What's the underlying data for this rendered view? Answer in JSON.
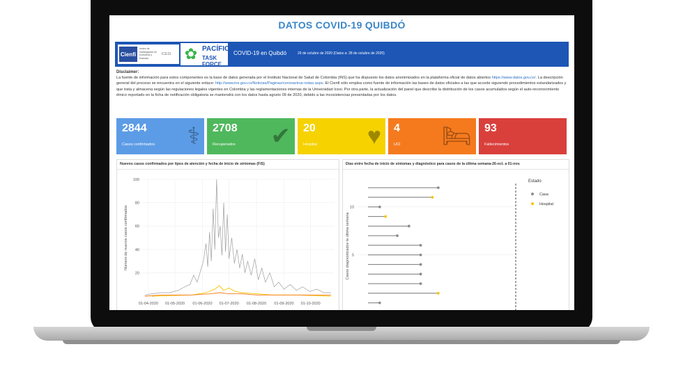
{
  "page": {
    "title": "DATOS COVID-19 QUIBDÓ"
  },
  "header": {
    "cienfi_logo": "Cienfi",
    "cienfi_sub": "centro de investigación en economía y finanzas",
    "icesi_logo": "ICESI",
    "pacifico_title": "PACÍFICO",
    "pacifico_sub": "TASK FORCE",
    "title": "COVID-19 en Quibdó",
    "date": "29 de octubre de 2020 (Datos a: 28 de octubre de 2020)"
  },
  "disclaimer": {
    "heading": "Disclaimer:",
    "p1": "La fuente de información para estos componentes es la base de datos generada por el Instituto Nacional de Salud de Colombia (INS) que ha dispuesto los datos anonimizados en la plataforma oficial de datos abiertos ",
    "link1": "https://www.datos.gov.co/",
    "p2": ". La descripción general del proceso se encuentra en el siguiente enlace: ",
    "link2": "http://www.ins.gov.co/Noticias/Paginas/coronavirus-notas.aspx",
    "p3": ". El Cienfi sólo emplea como fuente de información las bases de datos oficiales a las que accede siguiendo procedimientos estandarizados y que trata y almacena según las regulaciones legales vigentes en Colombia y las reglamentaciones internas de la Universidad Icesi. Por otra parte, la actualización del panel que describe la distribución de los casos acumulados según el auto-reconocimiento étnico reportado en la ficha de notificación obligatoria se mantendrá con los datos hasta agosto 09 de 2020, debido a las incosistencias presentadas por los datos."
  },
  "cards": [
    {
      "value": "2844",
      "label": "Casos confirmados",
      "color": "#5c9ce6",
      "icon": "stethoscope-icon",
      "glyph": "⚕"
    },
    {
      "value": "2708",
      "label": "Recuperados",
      "color": "#4fb85c",
      "icon": "checkmark-icon",
      "glyph": "✔"
    },
    {
      "value": "20",
      "label": "Hospital",
      "color": "#f5d200",
      "icon": "heartbeat-icon",
      "glyph": "♥"
    },
    {
      "value": "4",
      "label": "UCI",
      "color": "#f57a1e",
      "icon": "hospital-bed-icon",
      "glyph": "🛏"
    },
    {
      "value": "93",
      "label": "Fallecimientos",
      "color": "#d9403c",
      "icon": "none",
      "glyph": ""
    }
  ],
  "chart_data": [
    {
      "type": "line",
      "title": "Nuevos casos confirmados por tipos de atención y fecha de inicio de síntomas (FIS)",
      "ylabel": "Número de nuevos casos confirmados",
      "xlabel": "",
      "ylim": [
        0,
        100
      ],
      "yticks": [
        20,
        40,
        60,
        80,
        100
      ],
      "x_ticks": [
        "01-04-2020",
        "01-05-2020",
        "01-06-2020",
        "01-07-2020",
        "01-08-2020",
        "01-09-2020",
        "01-10-2020"
      ],
      "xlim": [
        "2020-03-25",
        "2020-10-28"
      ],
      "series": [
        {
          "color": "#9e9e9e",
          "points": [
            [
              "2020-03-28",
              1
            ],
            [
              "2020-04-05",
              2
            ],
            [
              "2020-04-15",
              3
            ],
            [
              "2020-04-25",
              3
            ],
            [
              "2020-05-05",
              5
            ],
            [
              "2020-05-12",
              8
            ],
            [
              "2020-05-18",
              10
            ],
            [
              "2020-05-22",
              18
            ],
            [
              "2020-05-26",
              12
            ],
            [
              "2020-05-30",
              22
            ],
            [
              "2020-06-02",
              30
            ],
            [
              "2020-06-05",
              45
            ],
            [
              "2020-06-07",
              25
            ],
            [
              "2020-06-09",
              55
            ],
            [
              "2020-06-11",
              30
            ],
            [
              "2020-06-13",
              75
            ],
            [
              "2020-06-15",
              40
            ],
            [
              "2020-06-17",
              100
            ],
            [
              "2020-06-19",
              50
            ],
            [
              "2020-06-21",
              60
            ],
            [
              "2020-06-23",
              35
            ],
            [
              "2020-06-25",
              80
            ],
            [
              "2020-06-27",
              38
            ],
            [
              "2020-06-29",
              70
            ],
            [
              "2020-07-01",
              32
            ],
            [
              "2020-07-04",
              50
            ],
            [
              "2020-07-07",
              28
            ],
            [
              "2020-07-10",
              40
            ],
            [
              "2020-07-13",
              24
            ],
            [
              "2020-07-16",
              36
            ],
            [
              "2020-07-19",
              20
            ],
            [
              "2020-07-22",
              30
            ],
            [
              "2020-07-26",
              18
            ],
            [
              "2020-07-30",
              32
            ],
            [
              "2020-08-03",
              14
            ],
            [
              "2020-08-07",
              24
            ],
            [
              "2020-08-11",
              12
            ],
            [
              "2020-08-16",
              20
            ],
            [
              "2020-08-21",
              8
            ],
            [
              "2020-08-26",
              12
            ],
            [
              "2020-09-01",
              6
            ],
            [
              "2020-09-08",
              10
            ],
            [
              "2020-09-15",
              5
            ],
            [
              "2020-09-22",
              8
            ],
            [
              "2020-09-30",
              4
            ],
            [
              "2020-10-08",
              6
            ],
            [
              "2020-10-16",
              3
            ],
            [
              "2020-10-24",
              3
            ]
          ]
        },
        {
          "color": "#f5c400",
          "points": [
            [
              "2020-04-05",
              0
            ],
            [
              "2020-05-20",
              1
            ],
            [
              "2020-06-05",
              3
            ],
            [
              "2020-06-15",
              6
            ],
            [
              "2020-06-20",
              9
            ],
            [
              "2020-06-25",
              5
            ],
            [
              "2020-07-01",
              7
            ],
            [
              "2020-07-08",
              4
            ],
            [
              "2020-07-16",
              3
            ],
            [
              "2020-08-01",
              2
            ],
            [
              "2020-08-20",
              1
            ],
            [
              "2020-09-15",
              1
            ],
            [
              "2020-10-24",
              0
            ]
          ]
        },
        {
          "color": "#f57a1e",
          "points": [
            [
              "2020-03-28",
              0
            ],
            [
              "2020-04-15",
              1
            ],
            [
              "2020-05-01",
              1
            ],
            [
              "2020-05-20",
              1
            ],
            [
              "2020-06-10",
              2
            ],
            [
              "2020-06-20",
              3
            ],
            [
              "2020-07-01",
              2
            ],
            [
              "2020-07-15",
              2
            ],
            [
              "2020-08-01",
              1
            ],
            [
              "2020-08-20",
              1
            ],
            [
              "2020-09-15",
              1
            ],
            [
              "2020-10-24",
              1
            ]
          ]
        }
      ]
    },
    {
      "type": "scatter",
      "title": "Días entre fecha de inicio de síntomas y diagnóstico para casos de la última semana-26-oct. a 01-nov.",
      "ylabel": "Casos diagnosticados la última semana",
      "yticks": [
        5,
        10
      ],
      "legend_title": "Estado",
      "legend": [
        {
          "name": "Casa",
          "color": "#8c8c8c"
        },
        {
          "name": "Hospital",
          "color": "#f5c400"
        }
      ],
      "legend_position": "right",
      "rows": [
        {
          "case": 0,
          "days": 12,
          "estado": "Casa"
        },
        {
          "case": 1,
          "days": 11,
          "estado": "Hospital"
        },
        {
          "case": 2,
          "days": 2,
          "estado": "Casa"
        },
        {
          "case": 3,
          "days": 3,
          "estado": "Hospital"
        },
        {
          "case": 4,
          "days": 7,
          "estado": "Casa"
        },
        {
          "case": 5,
          "days": 5,
          "estado": "Casa"
        },
        {
          "case": 6,
          "days": 9,
          "estado": "Casa"
        },
        {
          "case": 7,
          "days": 9,
          "estado": "Casa"
        },
        {
          "case": 8,
          "days": 9,
          "estado": "Casa"
        },
        {
          "case": 9,
          "days": 9,
          "estado": "Casa"
        },
        {
          "case": 10,
          "days": 9,
          "estado": "Casa"
        },
        {
          "case": 11,
          "days": 12,
          "estado": "Hospital"
        },
        {
          "case": 12,
          "days": 2,
          "estado": "Casa"
        }
      ]
    }
  ]
}
